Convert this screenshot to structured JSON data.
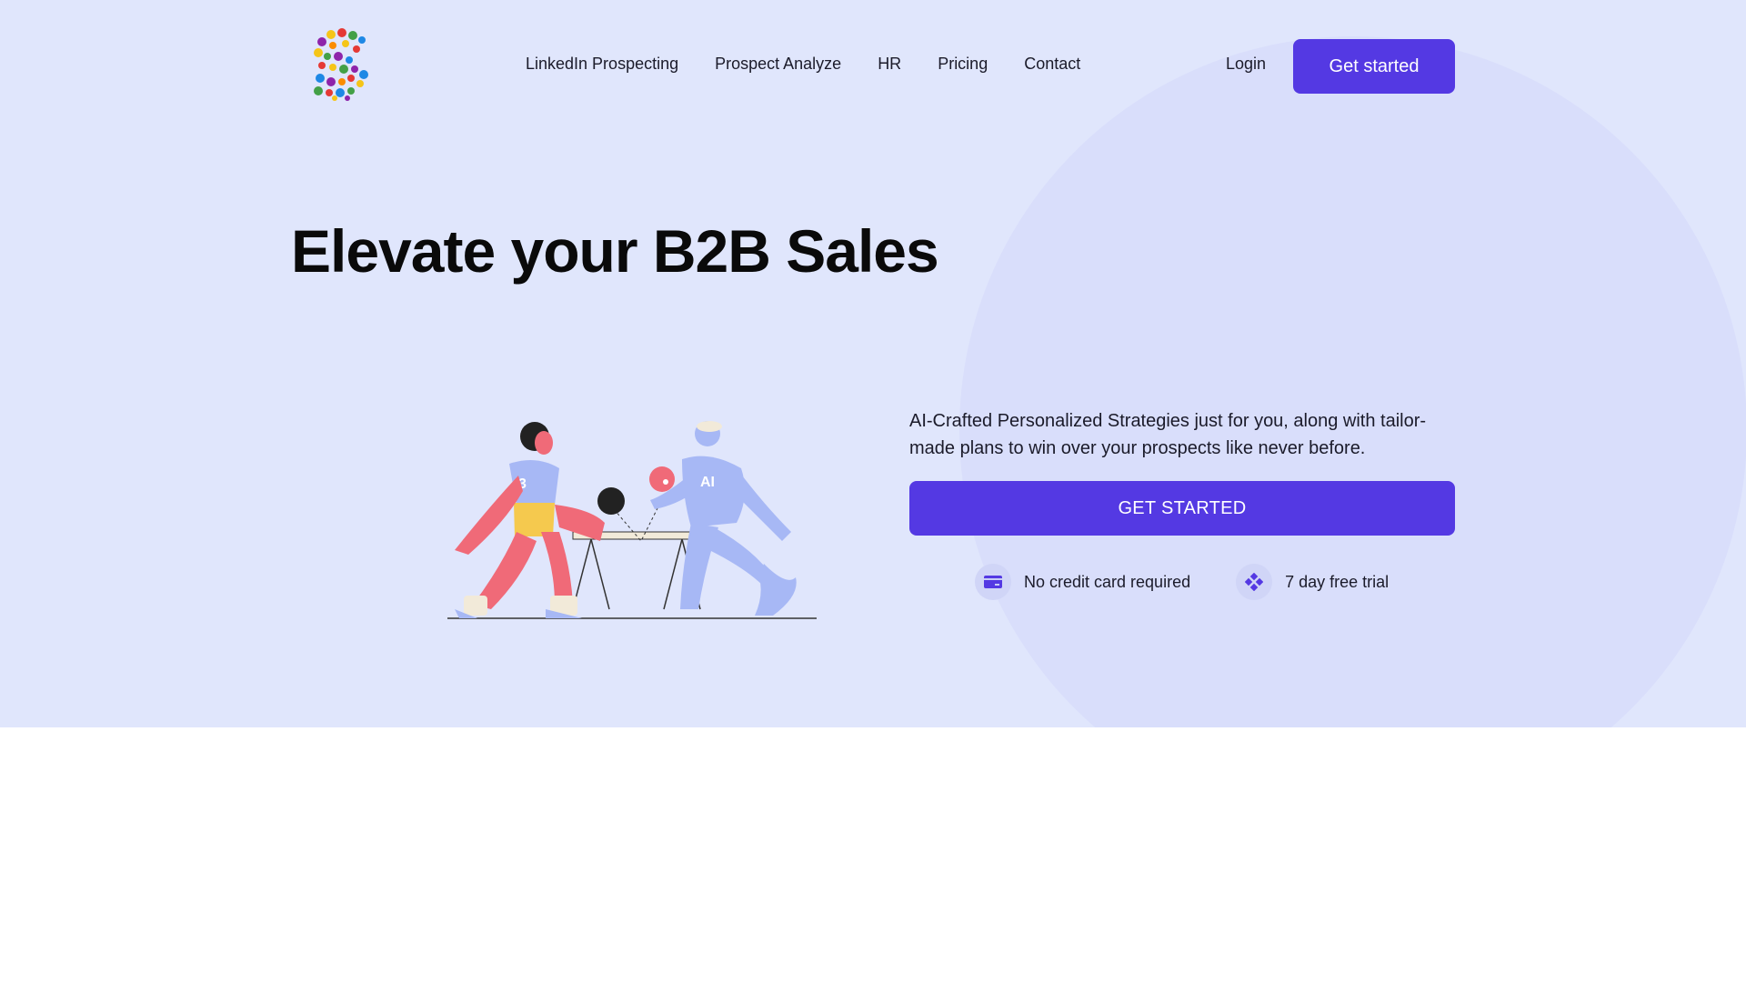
{
  "nav": {
    "items": [
      "LinkedIn Prospecting",
      "Prospect Analyze",
      "HR",
      "Pricing",
      "Contact"
    ],
    "login": "Login",
    "cta": "Get started"
  },
  "hero": {
    "title": "Elevate your B2B Sales",
    "description": "AI-Crafted Personalized Strategies just for you, along with tailor-made plans to win over your prospects like never before.",
    "cta": "GET STARTED",
    "perks": [
      {
        "icon": "credit-card-icon",
        "label": "No credit card required"
      },
      {
        "icon": "diamond-dots-icon",
        "label": "7 day free trial"
      }
    ],
    "illustration": {
      "player_number": "3",
      "ai_label": "AI"
    }
  },
  "colors": {
    "accent": "#5439e3",
    "hero_bg": "#e0e6fc",
    "circle": "#d9defb"
  }
}
